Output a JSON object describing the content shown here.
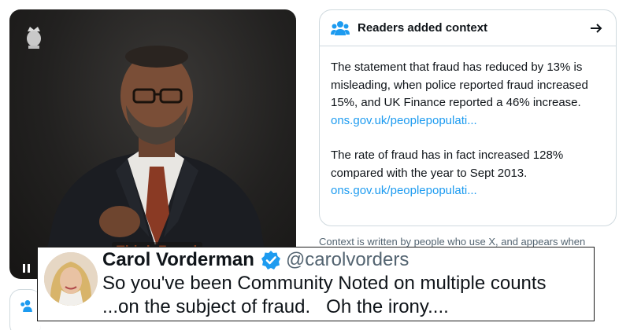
{
  "video": {
    "subtitle": "Think Fraud",
    "controls": {
      "play_state": "pause-icon"
    }
  },
  "context_card": {
    "title": "Readers added context",
    "paragraph1": "The statement that fraud has reduced by 13% is misleading, when police reported fraud increased 15%, and UK Finance reported a 46% increase.",
    "link1": "ons.gov.uk/peoplepopulati...",
    "paragraph2": "The rate of fraud has in fact increased 128% compared with the year to Sept 2013.",
    "link2": "ons.gov.uk/peoplepopulati...",
    "icons": {
      "header": "people-icon",
      "action": "arrow-right-icon"
    },
    "colors": {
      "link": "#1d9bf0",
      "border": "#cfd9de"
    }
  },
  "footnote": "Context is written by people who use X, and appears when",
  "quote": {
    "name": "Carol Vorderman",
    "handle": "@carolvorders",
    "line1": "So you've been Community Noted on multiple counts",
    "line2": "...on the subject of fraud.   Oh the irony....",
    "colors": {
      "verified": "#1d9bf0"
    }
  }
}
